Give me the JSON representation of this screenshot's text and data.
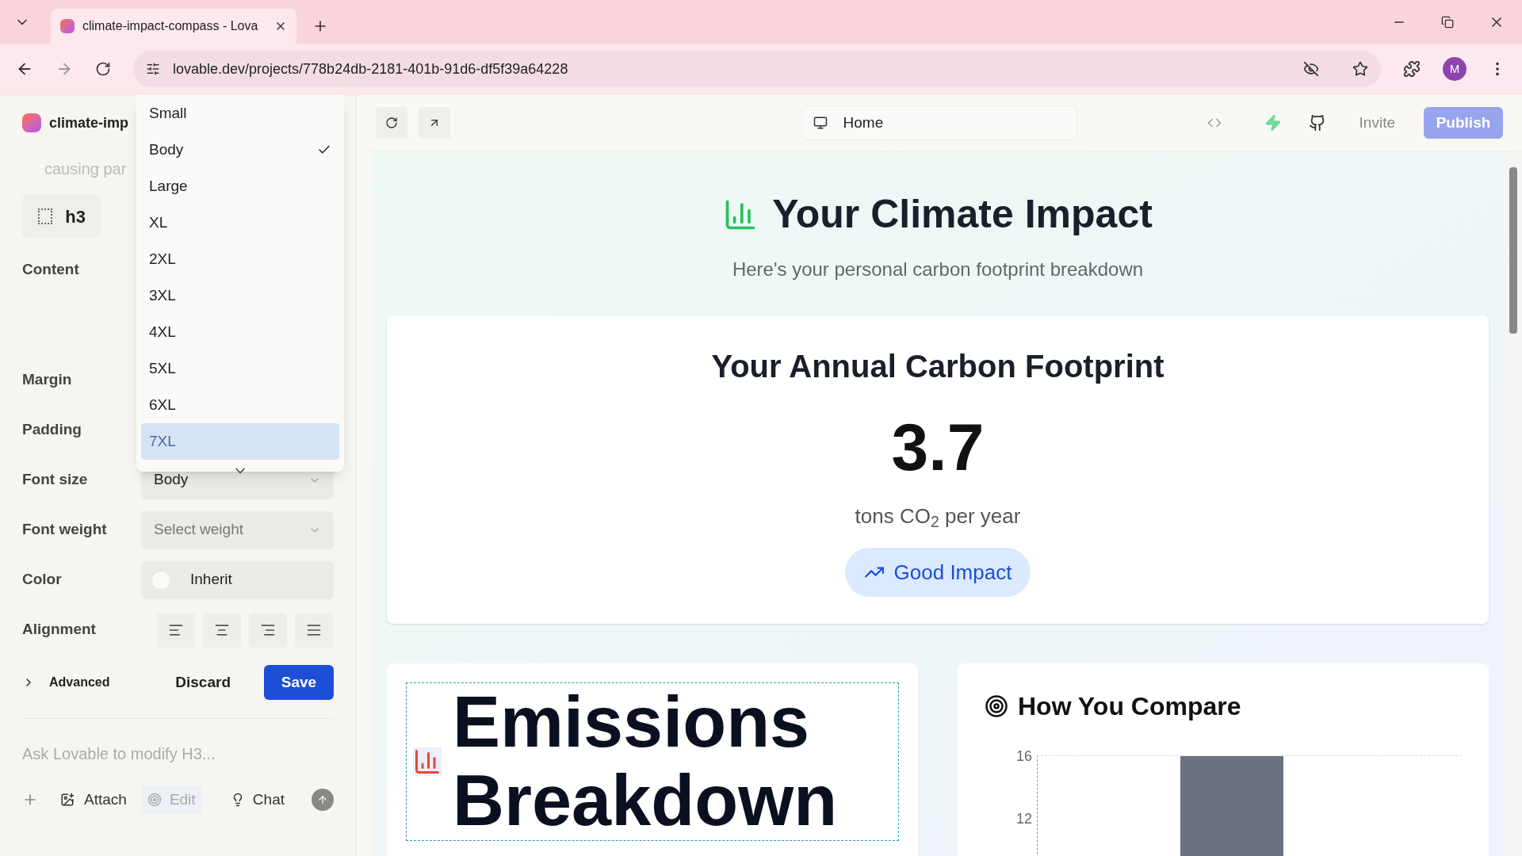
{
  "browser": {
    "tab_title": "climate-impact-compass - Lova",
    "url": "lovable.dev/projects/778b24db-2181-401b-91d6-df5f39a64228",
    "profile_initial": "M"
  },
  "project": {
    "name": "climate-imp"
  },
  "editor": {
    "snippet": "causing par",
    "element_tag": "h3"
  },
  "properties": [
    {
      "kind": "textarea",
      "label": "Content"
    },
    {
      "kind": "blank",
      "label": "Margin"
    },
    {
      "kind": "blank",
      "label": "Padding"
    },
    {
      "kind": "select",
      "label": "Font size",
      "value": "Body"
    },
    {
      "kind": "select",
      "label": "Font weight",
      "placeholder": "Select weight"
    },
    {
      "kind": "color",
      "label": "Color",
      "value": "Inherit"
    },
    {
      "kind": "alignment",
      "label": "Alignment",
      "options": [
        {
          "selected": false
        },
        {
          "selected": false
        },
        {
          "selected": false
        },
        {
          "selected": false
        }
      ]
    }
  ],
  "actions": {
    "advanced": {
      "label": "Advanced",
      "expanded": false
    },
    "discard": "Discard",
    "save": "Save"
  },
  "chat": {
    "placeholder": "Ask Lovable to modify H3...",
    "attach": "Attach",
    "edit": "Edit",
    "chat": "Chat"
  },
  "dropdown": {
    "items": [
      {
        "label": "Small",
        "checked": false,
        "selected": false
      },
      {
        "label": "Body",
        "checked": true,
        "selected": false
      },
      {
        "label": "Large",
        "checked": false,
        "selected": false
      },
      {
        "label": "XL",
        "checked": false,
        "selected": false
      },
      {
        "label": "2XL",
        "checked": false,
        "selected": false
      },
      {
        "label": "3XL",
        "checked": false,
        "selected": false
      },
      {
        "label": "4XL",
        "checked": false,
        "selected": false
      },
      {
        "label": "5XL",
        "checked": false,
        "selected": false
      },
      {
        "label": "6XL",
        "checked": false,
        "selected": false
      },
      {
        "label": "7XL",
        "checked": false,
        "selected": true
      }
    ]
  },
  "preview": {
    "route": "Home",
    "invite": "Invite",
    "publish": "Publish",
    "title": "Your Climate Impact",
    "subtitle": "Here's your personal carbon footprint breakdown",
    "footprint": {
      "heading": "Your Annual Carbon Footprint",
      "value": "3.7",
      "unit": "tons CO$_{2}$ per year",
      "badge": "Good Impact"
    },
    "breakdown": {
      "title": "Emissions Breakdown",
      "selected": true
    },
    "compare": {
      "title": "How You Compare",
      "y_tick_labels": [
        "16",
        "12"
      ]
    }
  }
}
